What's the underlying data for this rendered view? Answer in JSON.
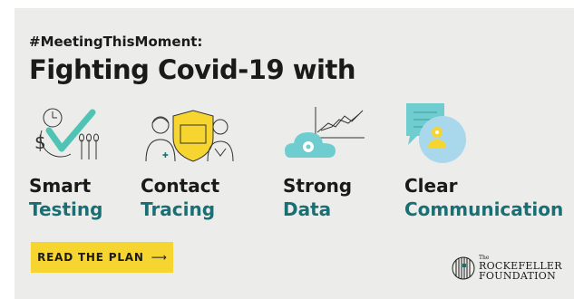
{
  "hashtag": "#MeetingThisMoment:",
  "headline": "Fighting Covid-19 with",
  "pillars": [
    {
      "line1": "Smart",
      "line2": "Testing",
      "icon": "testing-icon"
    },
    {
      "line1": "Contact",
      "line2": "Tracing",
      "icon": "contact-tracing-icon"
    },
    {
      "line1": "Strong",
      "line2": "Data",
      "icon": "data-cloud-icon"
    },
    {
      "line1": "Clear",
      "line2": "Communication",
      "icon": "communication-icon"
    }
  ],
  "cta": {
    "label": "READ THE PLAN",
    "arrow": "⟶"
  },
  "logo": {
    "the": "The",
    "line1": "ROCKEFELLER",
    "line2": "FOUNDATION"
  },
  "colors": {
    "background": "#ececea",
    "teal": "#1a6f75",
    "accent_teal": "#4fc3b4",
    "yellow": "#f6d530",
    "text": "#1a1a1a"
  }
}
